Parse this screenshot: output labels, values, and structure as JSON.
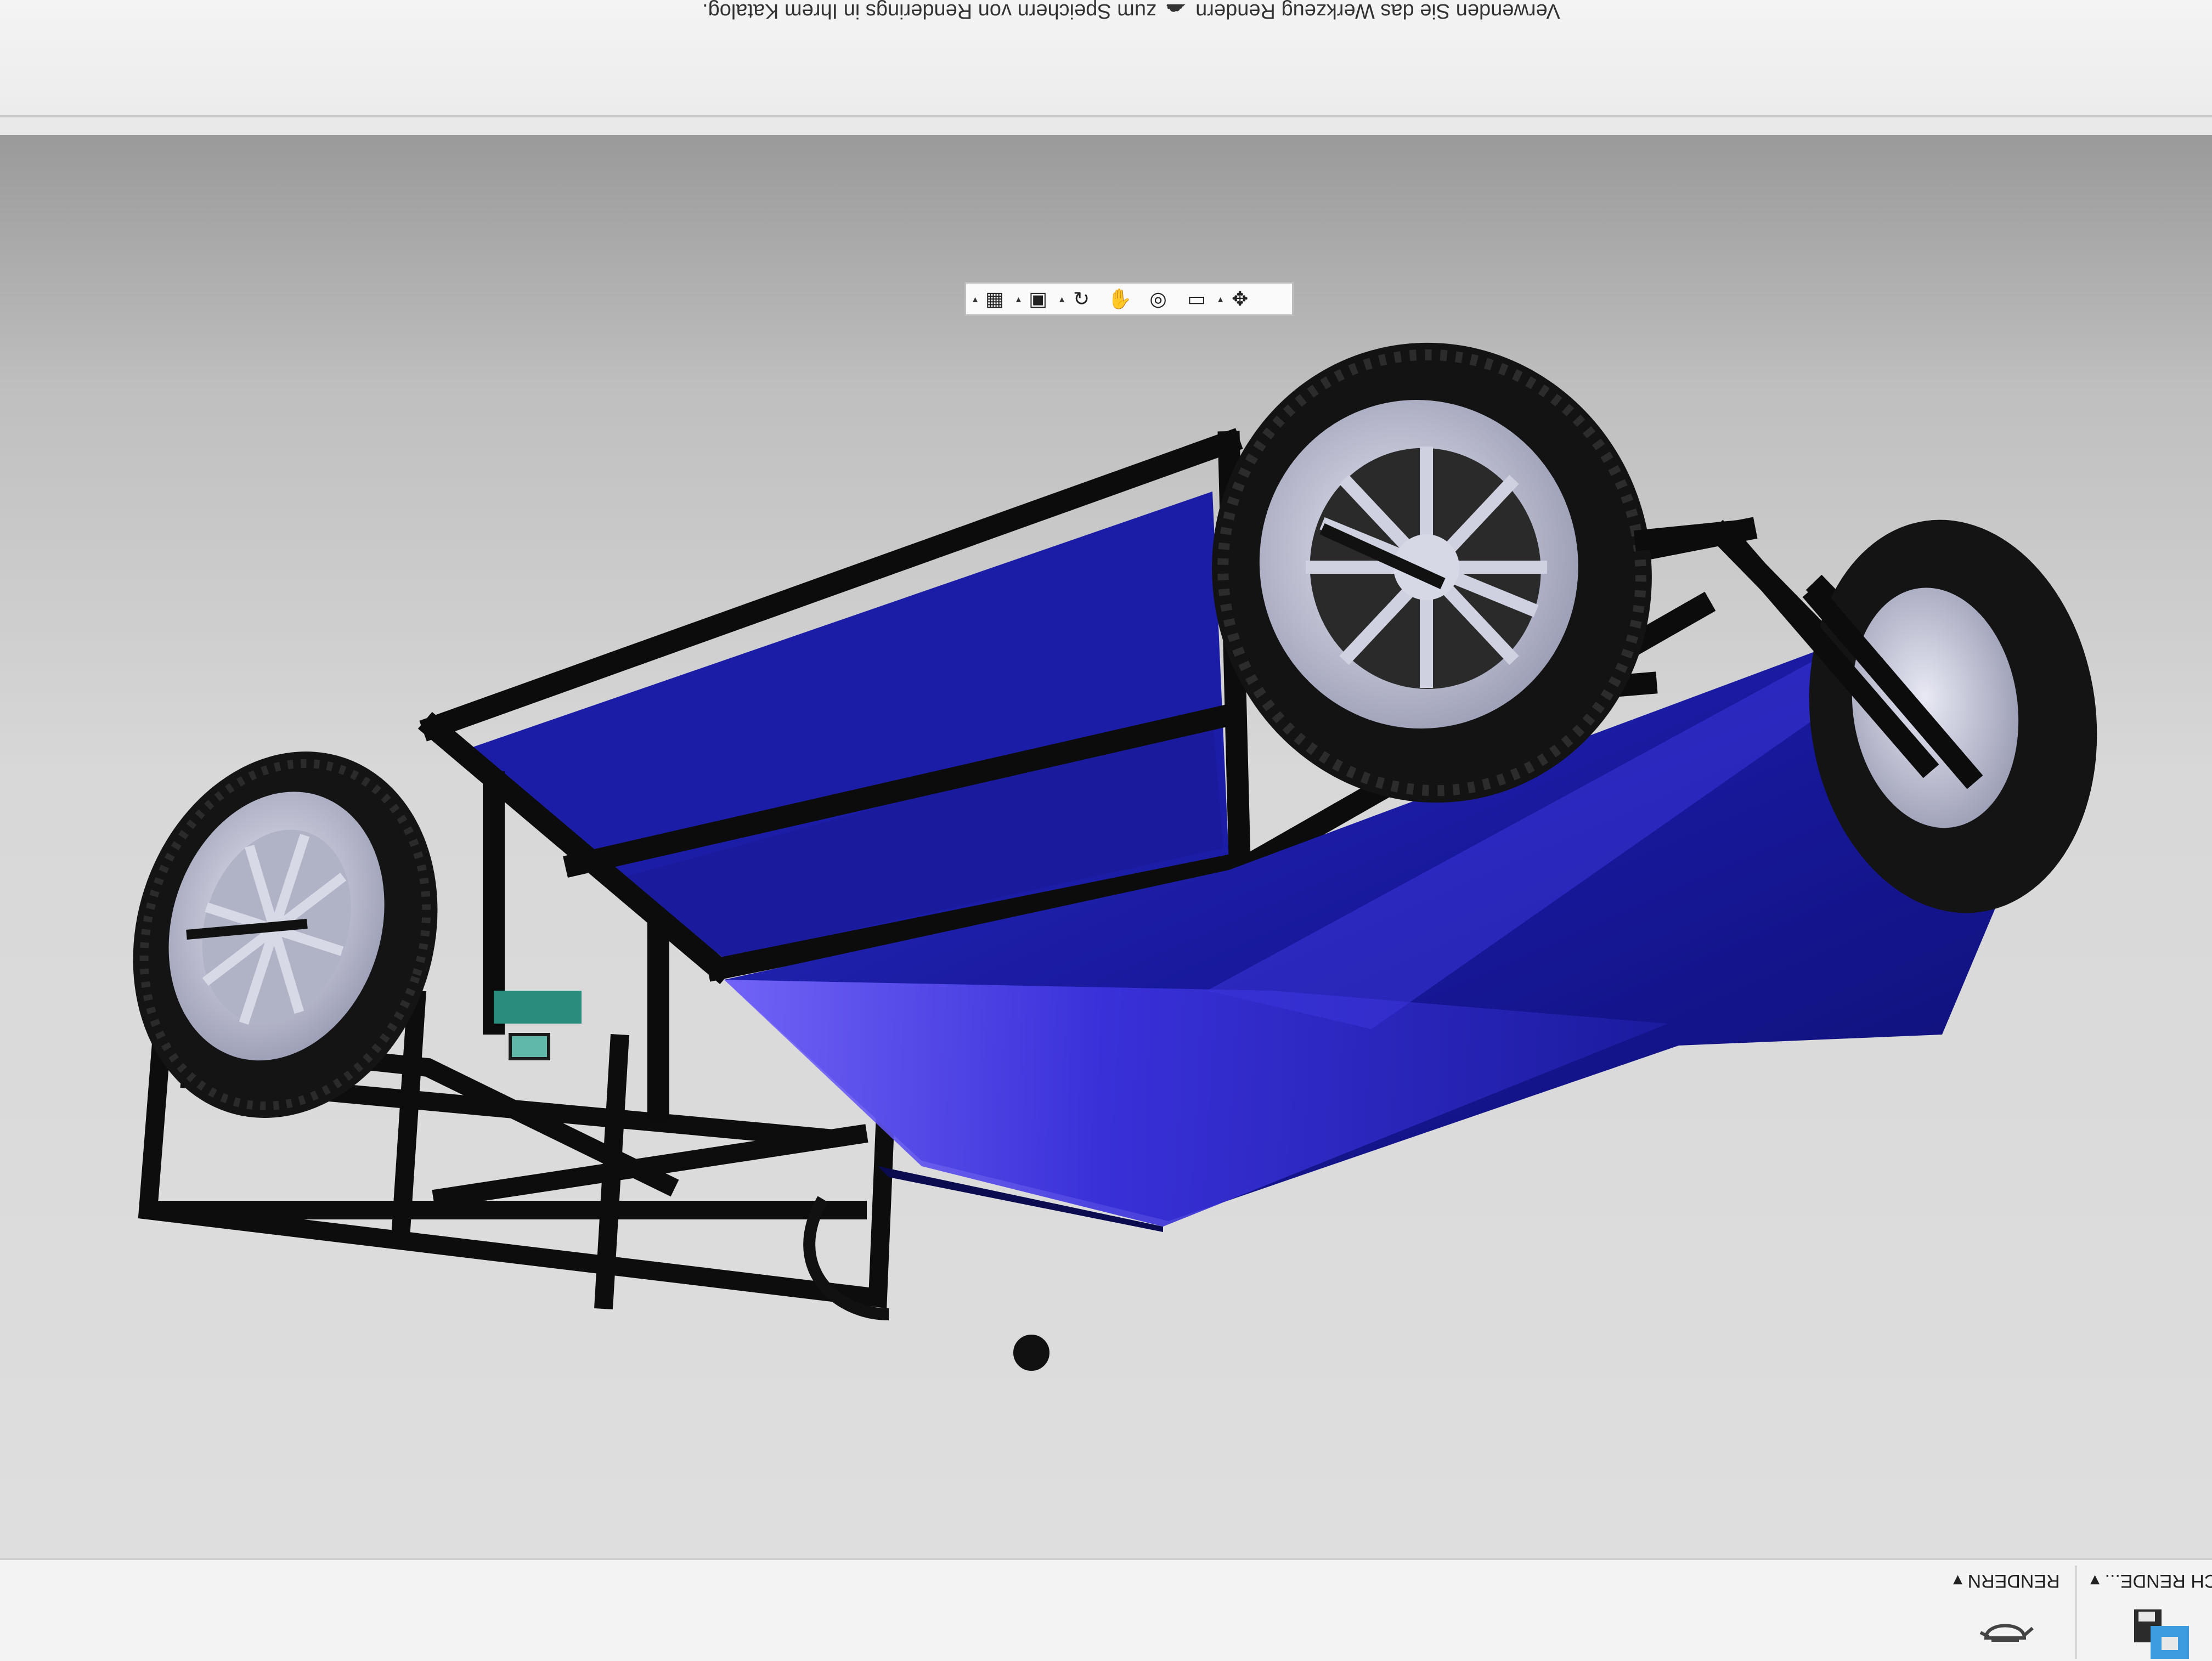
{
  "message_bar": {
    "text_before_icon": "Verwenden Sie das Werkzeug Rendern",
    "text_after_icon": "zum Speichern von Renderings in Ihrem Katalog."
  },
  "viewport_toolbar": {
    "buttons": [
      {
        "icon": "grid-display-icon"
      },
      {
        "icon": "visual-style-icon"
      },
      {
        "icon": "orbit-icon"
      },
      {
        "icon": "pan-icon"
      },
      {
        "icon": "look-at-icon"
      },
      {
        "icon": "display-settings-icon"
      },
      {
        "icon": "navigation-icon"
      }
    ]
  },
  "ribbon": {
    "group_render_label": "RENDERN",
    "group_right_label": "ICH RENDE..."
  },
  "colors": {
    "body_panel": "#1e1f9e",
    "frame": "#101010",
    "wheel_rim": "#c6c8d8",
    "tire": "#141414"
  }
}
